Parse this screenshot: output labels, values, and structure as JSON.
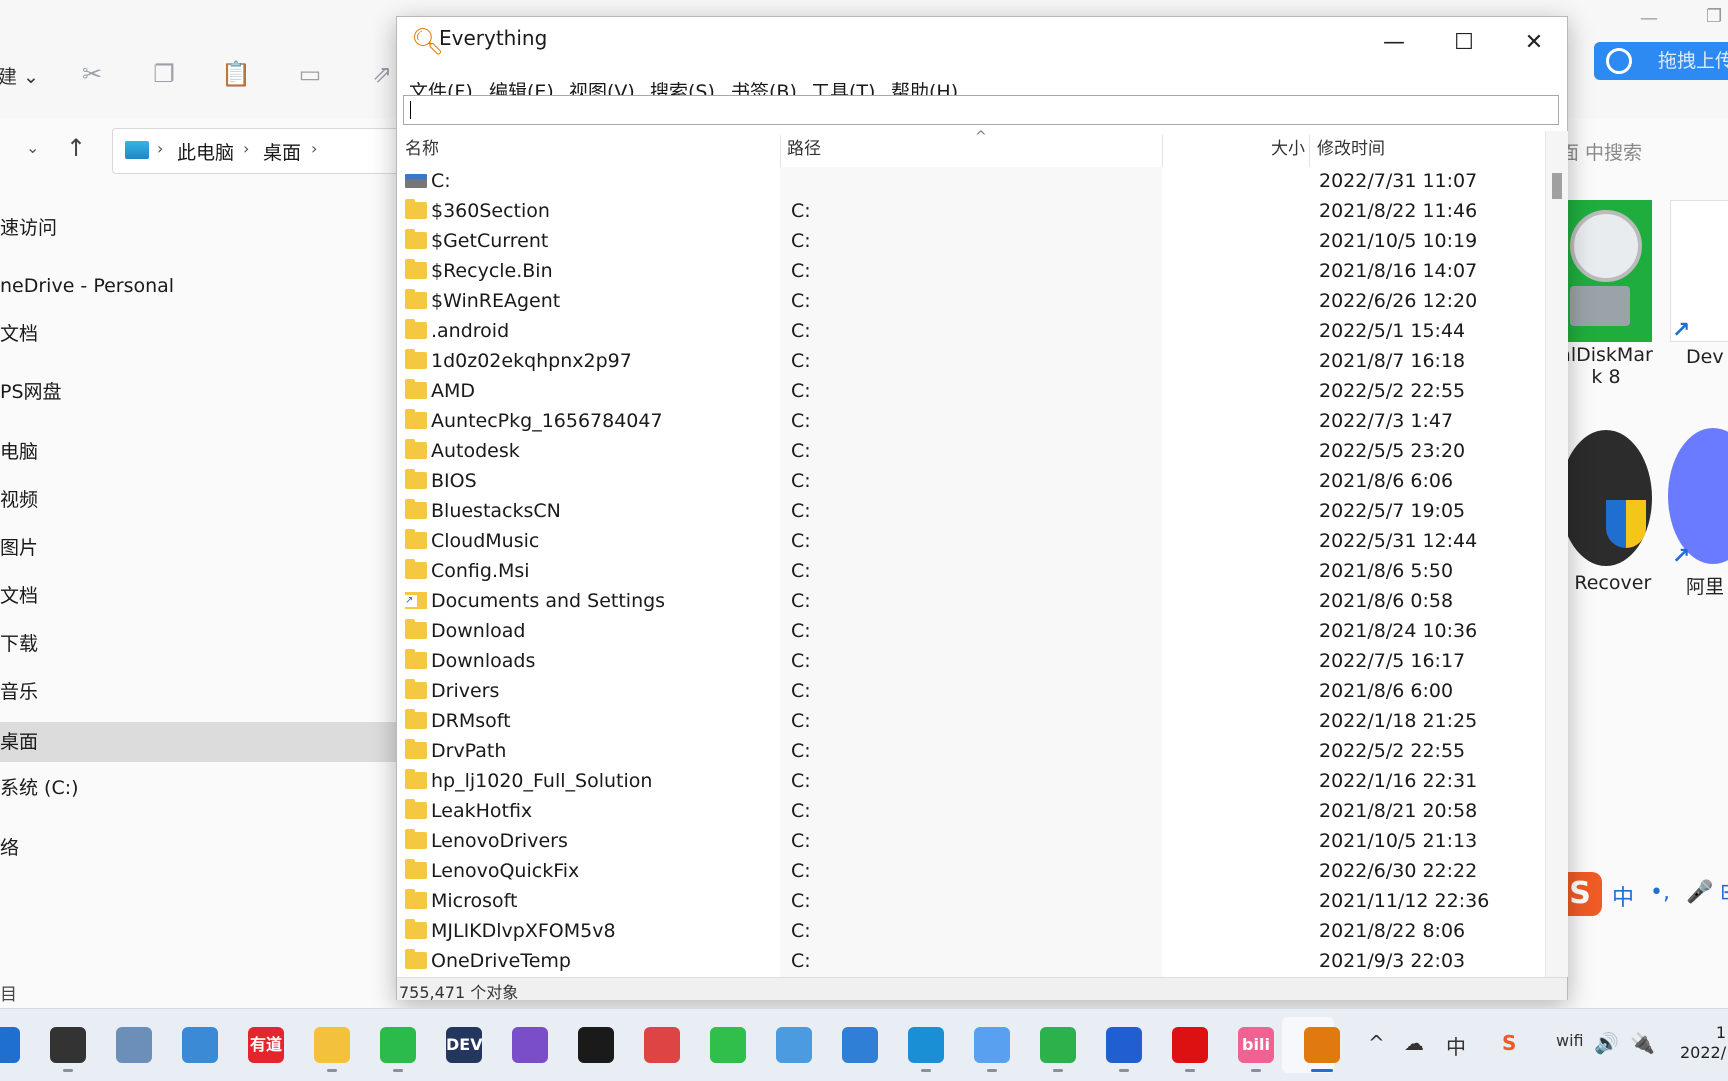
{
  "explorer": {
    "new_label": "建 ⌄",
    "breadcrumb": [
      "此电脑",
      "桌面"
    ],
    "search_placeholder": "面 中搜索",
    "nav": [
      "速访问",
      "neDrive - Personal",
      "文档",
      "PS网盘",
      "电脑",
      "视频",
      "图片",
      "文档",
      "下载",
      "音乐",
      "桌面",
      "系统 (C:)",
      "络"
    ],
    "selected_nav_index": 10,
    "footer": "目"
  },
  "desktop": {
    "icons": [
      {
        "label": "alDiskMar\nk 8"
      },
      {
        "label": "Dev"
      },
      {
        "label": "o Recover"
      },
      {
        "label": "阿里"
      }
    ],
    "baidu_button": "拖拽上传"
  },
  "sogou": {
    "logo": "S",
    "items": [
      "中",
      "•,",
      "🎤",
      "⊞"
    ]
  },
  "everything": {
    "title": "Everything",
    "window_buttons": {
      "minimize": "—",
      "maximize": "☐",
      "close": "✕"
    },
    "menu": [
      "文件(F)",
      "编辑(E)",
      "视图(V)",
      "搜索(S)",
      "书签(B)",
      "工具(T)",
      "帮助(H)"
    ],
    "search_value": "",
    "columns": {
      "name": "名称",
      "path": "路径",
      "size": "大小",
      "modified": "修改时间"
    },
    "rows": [
      {
        "name": "C:",
        "path": "",
        "date": "2022/7/31 11:07",
        "icon": "drive"
      },
      {
        "name": "$360Section",
        "path": "C:",
        "date": "2021/8/22 11:46",
        "icon": "folder"
      },
      {
        "name": "$GetCurrent",
        "path": "C:",
        "date": "2021/10/5 10:19",
        "icon": "folder"
      },
      {
        "name": "$Recycle.Bin",
        "path": "C:",
        "date": "2021/8/16 14:07",
        "icon": "folder"
      },
      {
        "name": "$WinREAgent",
        "path": "C:",
        "date": "2022/6/26 12:20",
        "icon": "folder"
      },
      {
        "name": ".android",
        "path": "C:",
        "date": "2022/5/1 15:44",
        "icon": "folder"
      },
      {
        "name": "1d0z02ekqhpnx2p97",
        "path": "C:",
        "date": "2021/8/7 16:18",
        "icon": "folder"
      },
      {
        "name": "AMD",
        "path": "C:",
        "date": "2022/5/2 22:55",
        "icon": "folder"
      },
      {
        "name": "AuntecPkg_1656784047",
        "path": "C:",
        "date": "2022/7/3 1:47",
        "icon": "folder"
      },
      {
        "name": "Autodesk",
        "path": "C:",
        "date": "2022/5/5 23:20",
        "icon": "folder"
      },
      {
        "name": "BIOS",
        "path": "C:",
        "date": "2021/8/6 6:06",
        "icon": "folder"
      },
      {
        "name": "BluestacksCN",
        "path": "C:",
        "date": "2022/5/7 19:05",
        "icon": "folder"
      },
      {
        "name": "CloudMusic",
        "path": "C:",
        "date": "2022/5/31 12:44",
        "icon": "folder"
      },
      {
        "name": "Config.Msi",
        "path": "C:",
        "date": "2021/8/6 5:50",
        "icon": "folder"
      },
      {
        "name": "Documents and Settings",
        "path": "C:",
        "date": "2021/8/6 0:58",
        "icon": "link"
      },
      {
        "name": "Download",
        "path": "C:",
        "date": "2021/8/24 10:36",
        "icon": "folder"
      },
      {
        "name": "Downloads",
        "path": "C:",
        "date": "2022/7/5 16:17",
        "icon": "folder"
      },
      {
        "name": "Drivers",
        "path": "C:",
        "date": "2021/8/6 6:00",
        "icon": "folder"
      },
      {
        "name": "DRMsoft",
        "path": "C:",
        "date": "2022/1/18 21:25",
        "icon": "folder"
      },
      {
        "name": "DrvPath",
        "path": "C:",
        "date": "2022/5/2 22:55",
        "icon": "folder"
      },
      {
        "name": "hp_lj1020_Full_Solution",
        "path": "C:",
        "date": "2022/1/16 22:31",
        "icon": "folder"
      },
      {
        "name": "LeakHotfix",
        "path": "C:",
        "date": "2021/8/21 20:58",
        "icon": "folder"
      },
      {
        "name": "LenovoDrivers",
        "path": "C:",
        "date": "2021/10/5 21:13",
        "icon": "folder"
      },
      {
        "name": "LenovoQuickFix",
        "path": "C:",
        "date": "2022/6/30 22:22",
        "icon": "folder"
      },
      {
        "name": "Microsoft",
        "path": "C:",
        "date": "2021/11/12 22:36",
        "icon": "folder"
      },
      {
        "name": "MJLIKDlvpXFOM5v8",
        "path": "C:",
        "date": "2021/8/22 8:06",
        "icon": "folder"
      },
      {
        "name": "OneDriveTemp",
        "path": "C:",
        "date": "2021/9/3 22:03",
        "icon": "folder"
      }
    ],
    "status": "755,471 个对象"
  },
  "taskbar": {
    "apps": [
      {
        "name": "start",
        "label": "",
        "color": "#1f6fd1"
      },
      {
        "name": "task-view",
        "label": "",
        "color": "#333333"
      },
      {
        "name": "perf-monitor",
        "label": "",
        "color": "#6b8fb8"
      },
      {
        "name": "control-panel",
        "label": "",
        "color": "#3a8ad6"
      },
      {
        "name": "youdao",
        "label": "有道",
        "color": "#e3262d"
      },
      {
        "name": "file-explorer",
        "label": "",
        "color": "#f4c13d"
      },
      {
        "name": "wechat",
        "label": "",
        "color": "#2bbb4a"
      },
      {
        "name": "dev-cpp",
        "label": "DEV",
        "color": "#24355e"
      },
      {
        "name": "visual-studio",
        "label": "",
        "color": "#7b4ec9"
      },
      {
        "name": "qq",
        "label": "",
        "color": "#1a1a1a"
      },
      {
        "name": "snipping-tool",
        "label": "",
        "color": "#d44"
      },
      {
        "name": "music",
        "label": "",
        "color": "#2fbf4a"
      },
      {
        "name": "paint",
        "label": "",
        "color": "#4a9be0"
      },
      {
        "name": "notepad",
        "label": "",
        "color": "#2f7fd6"
      },
      {
        "name": "edge",
        "label": "",
        "color": "#1a8fd6"
      },
      {
        "name": "baidu-netdisk",
        "label": "",
        "color": "#5aa0f0"
      },
      {
        "name": "apps-grid",
        "label": "",
        "color": "#2bb24a"
      },
      {
        "name": "feishu",
        "label": "",
        "color": "#1f5fd1"
      },
      {
        "name": "recorder",
        "label": "",
        "color": "#d11"
      },
      {
        "name": "bilibili",
        "label": "bili",
        "color": "#f06292"
      },
      {
        "name": "everything",
        "label": "",
        "color": "#e07a10"
      }
    ],
    "tray": [
      "^",
      "☁",
      "中",
      "S",
      "wifi",
      "🔊",
      "🔌"
    ],
    "clock_time": "1",
    "clock_date": "2022/"
  }
}
